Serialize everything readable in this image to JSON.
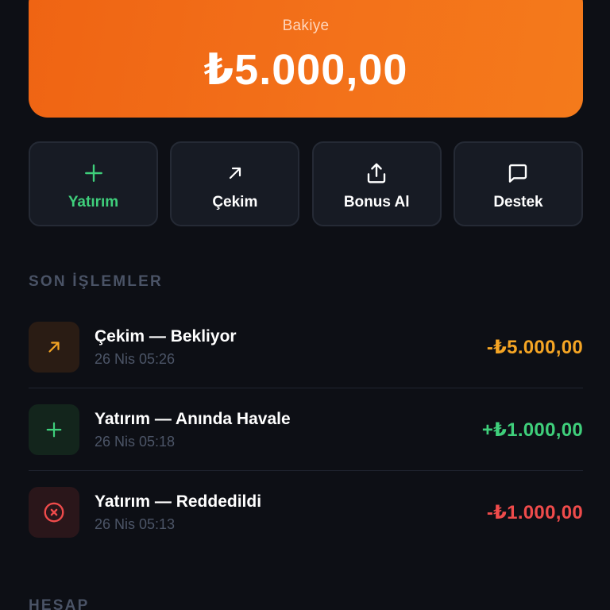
{
  "balance": {
    "label": "Bakiye",
    "amount": "₺5.000,00"
  },
  "actions": [
    {
      "label": "Yatırım",
      "icon": "plus-icon",
      "color": "#3fcf7b"
    },
    {
      "label": "Çekim",
      "icon": "arrow-up-right-icon",
      "color": "#ffffff"
    },
    {
      "label": "Bonus Al",
      "icon": "share-upload-icon",
      "color": "#ffffff"
    },
    {
      "label": "Destek",
      "icon": "chat-bubble-icon",
      "color": "#ffffff"
    }
  ],
  "sections": {
    "recent": "SON İŞLEMLER",
    "account": "HESAP"
  },
  "transactions": [
    {
      "title": "Çekim — Bekliyor",
      "time": "26 Nis 05:26",
      "amount": "-₺5.000,00",
      "icon": "arrow-up-right-icon",
      "color": "#f5a524"
    },
    {
      "title": "Yatırım — Anında Havale",
      "time": "26 Nis 05:18",
      "amount": "+₺1.000,00",
      "icon": "plus-icon",
      "color": "#3fcf7b"
    },
    {
      "title": "Yatırım — Reddedildi",
      "time": "26 Nis 05:13",
      "amount": "-₺1.000,00",
      "icon": "x-circle-icon",
      "color": "#ef4b4b"
    }
  ],
  "colors": {
    "background": "#0d0f15",
    "accent": "#f26b16",
    "pending": "#f5a524",
    "success": "#3fcf7b",
    "danger": "#ef4b4b"
  }
}
